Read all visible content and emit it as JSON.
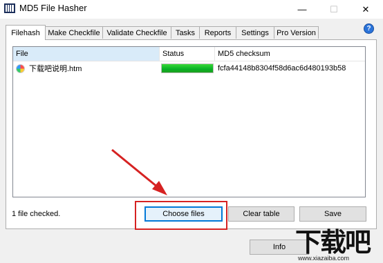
{
  "window": {
    "title": "MD5 File Hasher",
    "min_glyph": "—",
    "max_glyph": "☐",
    "close_glyph": "✕"
  },
  "tabs": [
    {
      "label": "Filehash",
      "active": true
    },
    {
      "label": "Make Checkfile"
    },
    {
      "label": "Validate Checkfile"
    },
    {
      "label": "Tasks"
    },
    {
      "label": "Reports"
    },
    {
      "label": "Settings"
    },
    {
      "label": "Pro Version"
    }
  ],
  "help": {
    "glyph": "?"
  },
  "table": {
    "columns": [
      "File",
      "Status",
      "MD5 checksum"
    ],
    "rows": [
      {
        "file": "下载吧说明.htm",
        "status_progress": 1.0,
        "md5": "fcfa44148b8304f58d6ac6d480193b58"
      }
    ]
  },
  "status_text": "1 file checked.",
  "buttons": {
    "choose_files": "Choose files",
    "clear_table": "Clear table",
    "save": "Save",
    "info": "Info"
  },
  "watermark": {
    "text": "下载吧",
    "url": "www.xiazaiba.com"
  },
  "colors": {
    "progress": "#06b025",
    "annotation": "#d62222",
    "accent": "#0078d7"
  }
}
